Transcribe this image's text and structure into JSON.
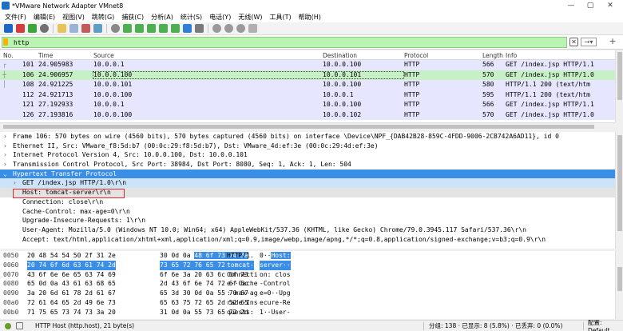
{
  "window": {
    "title": "*VMware Network Adapter VMnet8"
  },
  "menu": [
    "文件(F)",
    "编辑(E)",
    "视图(V)",
    "跳转(G)",
    "捕获(C)",
    "分析(A)",
    "统计(S)",
    "电话(Y)",
    "无线(W)",
    "工具(T)",
    "帮助(H)"
  ],
  "filter": {
    "value": "http"
  },
  "packet_list": {
    "columns": [
      "No.",
      "Time",
      "Source",
      "Destination",
      "Protocol",
      "Length",
      "Info"
    ],
    "rows": [
      {
        "no": "101",
        "time": "24.905983",
        "src": "10.0.0.1",
        "dst": "10.0.0.100",
        "proto": "HTTP",
        "len": "566",
        "info": "GET /index.jsp HTTP/1.1"
      },
      {
        "no": "106",
        "time": "24.906957",
        "src": "10.0.0.100",
        "dst": "10.0.0.101",
        "proto": "HTTP",
        "len": "570",
        "info": "GET /index.jsp HTTP/1.0"
      },
      {
        "no": "108",
        "time": "24.921225",
        "src": "10.0.0.101",
        "dst": "10.0.0.100",
        "proto": "HTTP",
        "len": "580",
        "info": "HTTP/1.1 200  (text/htm"
      },
      {
        "no": "112",
        "time": "24.921713",
        "src": "10.0.0.100",
        "dst": "10.0.0.1",
        "proto": "HTTP",
        "len": "595",
        "info": "HTTP/1.1 200  (text/htm"
      },
      {
        "no": "121",
        "time": "27.192933",
        "src": "10.0.0.1",
        "dst": "10.0.0.100",
        "proto": "HTTP",
        "len": "566",
        "info": "GET /index.jsp HTTP/1.1"
      },
      {
        "no": "126",
        "time": "27.193816",
        "src": "10.0.0.100",
        "dst": "10.0.0.102",
        "proto": "HTTP",
        "len": "570",
        "info": "GET /index.jsp HTTP/1.0"
      }
    ]
  },
  "details": [
    "Frame 106: 570 bytes on wire (4560 bits), 570 bytes captured (4560 bits) on interface \\Device\\NPF_{DAB42B28-859C-4FDD-9006-2CB742A6AD11}, id 0",
    "Ethernet II, Src: VMware_f8:5d:b7 (00:0c:29:f8:5d:b7), Dst: VMware_4d:ef:3e (00:0c:29:4d:ef:3e)",
    "Internet Protocol Version 4, Src: 10.0.0.100, Dst: 10.0.0.101",
    "Transmission Control Protocol, Src Port: 38984, Dst Port: 8080, Seq: 1, Ack: 1, Len: 504",
    "Hypertext Transfer Protocol",
    "GET /index.jsp HTTP/1.0\\r\\n",
    "Host: tomcat-server\\r\\n",
    "Connection: close\\r\\n",
    "Cache-Control: max-age=0\\r\\n",
    "Upgrade-Insecure-Requests: 1\\r\\n",
    "User-Agent: Mozilla/5.0 (Windows NT 10.0; Win64; x64) AppleWebKit/537.36 (KHTML, like Gecko) Chrome/79.0.3945.117 Safari/537.36\\r\\n",
    "Accept: text/html,application/xhtml+xml,application/xml;q=0.9,image/webp,image/apng,*/*;q=0.8,application/signed-exchange;v=b3;q=0.9\\r\\n"
  ],
  "bytes": [
    {
      "off": "0050",
      "hex1": "20 48 54 54 50 2f 31 2e",
      "hex2": "30 0d 0a 48 6f 73 74 3a",
      "asc1": " HTTP/1.",
      "asc2": "0··Host:"
    },
    {
      "off": "0060",
      "hex1": "20 74 6f 6d 63 61 74 2d",
      "hex2": "73 65 72 76 65 72 0d 0a",
      "asc1": " tomcat-",
      "asc2": "server··"
    },
    {
      "off": "0070",
      "hex1": "43 6f 6e 6e 65 63 74 69",
      "hex2": "6f 6e 3a 20 63 6c 6f 73",
      "asc1": "Connecti",
      "asc2": "on: clos"
    },
    {
      "off": "0080",
      "hex1": "65 0d 0a 43 61 63 68 65",
      "hex2": "2d 43 6f 6e 74 72 6f 6c",
      "asc1": "e··Cache",
      "asc2": "-Control"
    },
    {
      "off": "0090",
      "hex1": "3a 20 6d 61 78 2d 61 67",
      "hex2": "65 3d 30 0d 0a 55 70 67",
      "asc1": ": max-ag",
      "asc2": "e=0··Upg"
    },
    {
      "off": "00a0",
      "hex1": "72 61 64 65 2d 49 6e 73",
      "hex2": "65 63 75 72 65 2d 52 65",
      "asc1": "rade-Ins",
      "asc2": "ecure-Re"
    },
    {
      "off": "00b0",
      "hex1": "71 75 65 73 74 73 3a 20",
      "hex2": "31 0d 0a 55 73 65 72 2d",
      "asc1": "quests: ",
      "asc2": "1··User-"
    }
  ],
  "status": {
    "field": "HTTP Host (http.host), 21 byte(s)",
    "stats": "分组: 138 · 已显示: 8 (5.8%) · 已丢弃: 0 (0.0%)",
    "profile": "配置: Default"
  },
  "colors": {
    "filter_bg": "#b9f5b0",
    "row_bg": "#e7e6ff",
    "selected_row": "#c8f0c6",
    "highlight": "#3b8ee5",
    "annotation": "#e0262c"
  }
}
